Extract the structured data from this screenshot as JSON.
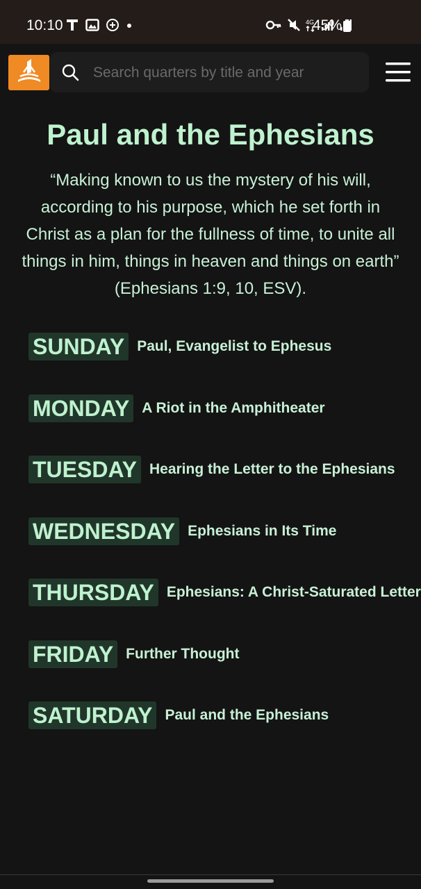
{
  "status": {
    "time": "10:10",
    "battery": "45%",
    "network": "4G"
  },
  "search": {
    "placeholder": "Search quarters by title and year"
  },
  "lesson": {
    "title": "Paul and the Ephesians",
    "quote": "“Making known to us the mystery of his will, according to his purpose, which he set forth in Christ as a plan for the fullness of time, to unite all things in him, things in heaven and things on earth” (Ephesians 1:9, 10, ESV)."
  },
  "days": [
    {
      "day": "SUNDAY",
      "title": "Paul, Evangelist to Ephesus"
    },
    {
      "day": "MONDAY",
      "title": "A Riot in the Amphitheater"
    },
    {
      "day": "TUESDAY",
      "title": "Hearing the Letter to the Ephesians"
    },
    {
      "day": "WEDNESDAY",
      "title": "Ephesians in Its Time"
    },
    {
      "day": "THURSDAY",
      "title": "Ephesians: A Christ-Saturated Letter"
    },
    {
      "day": "FRIDAY",
      "title": "Further Thought"
    },
    {
      "day": "SATURDAY",
      "title": "Paul and the Ephesians"
    }
  ],
  "colors": {
    "accent_logo": "#f08a24",
    "text_green": "#bff2cf",
    "badge_bg": "#21362a",
    "background": "#141414"
  }
}
